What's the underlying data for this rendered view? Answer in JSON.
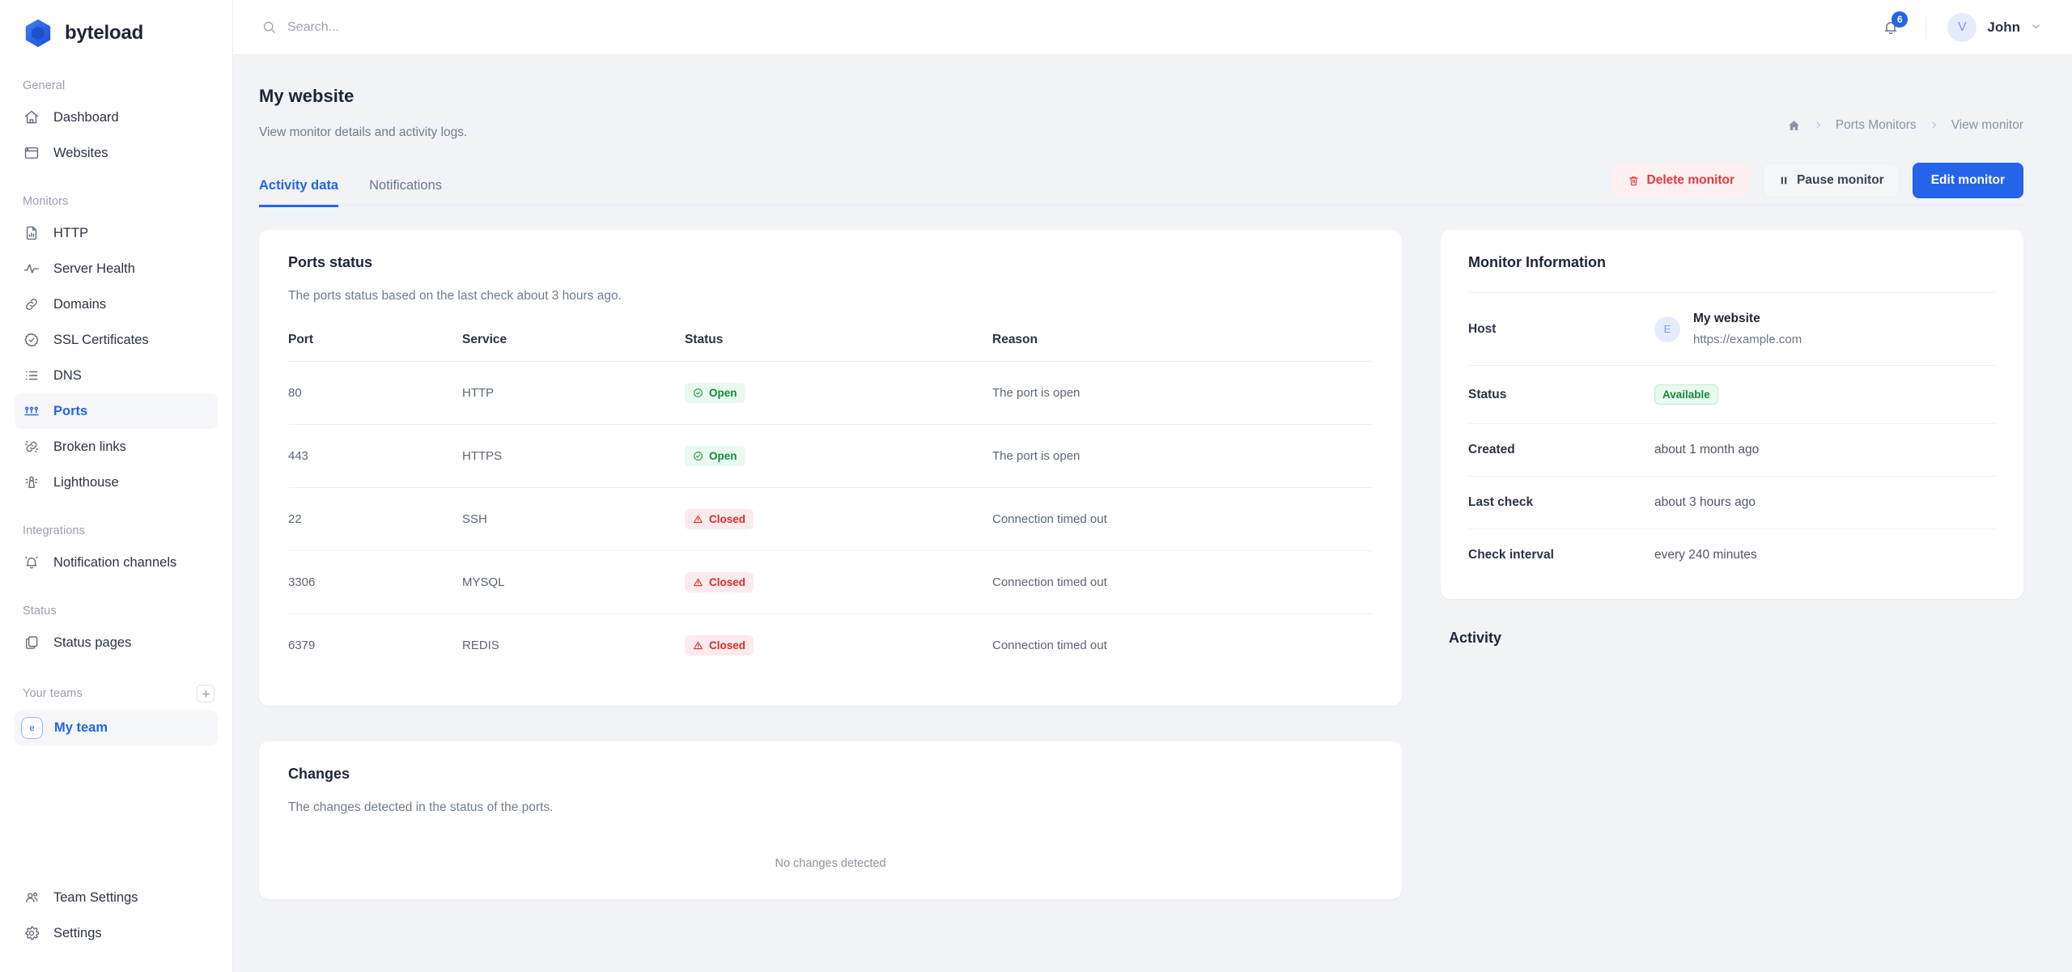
{
  "brand": {
    "name": "byteload",
    "logo_icon": "hexagon-logo",
    "accent": "#2563eb"
  },
  "sidebar": {
    "sections": [
      {
        "label": "General",
        "items": [
          {
            "label": "Dashboard",
            "icon": "home-icon"
          },
          {
            "label": "Websites",
            "icon": "browser-window-icon"
          }
        ]
      },
      {
        "label": "Monitors",
        "items": [
          {
            "label": "HTTP",
            "icon": "document-chart-icon"
          },
          {
            "label": "Server Health",
            "icon": "pulse-icon"
          },
          {
            "label": "Domains",
            "icon": "link-icon"
          },
          {
            "label": "SSL Certificates",
            "icon": "seal-check-icon"
          },
          {
            "label": "DNS",
            "icon": "list-icon"
          },
          {
            "label": "Ports",
            "icon": "ports-icon",
            "active": true
          },
          {
            "label": "Broken links",
            "icon": "broken-link-icon"
          },
          {
            "label": "Lighthouse",
            "icon": "lighthouse-icon"
          }
        ]
      },
      {
        "label": "Integrations",
        "items": [
          {
            "label": "Notification channels",
            "icon": "bell-ring-icon"
          }
        ]
      },
      {
        "label": "Status",
        "items": [
          {
            "label": "Status pages",
            "icon": "copy-pages-icon"
          }
        ]
      }
    ],
    "teams_label": "Your teams",
    "add_team_icon": "plus-icon",
    "team": {
      "label": "My team",
      "avatar_letter": "e"
    },
    "bottom_items": [
      {
        "label": "Team Settings",
        "icon": "users-group-icon"
      },
      {
        "label": "Settings",
        "icon": "gear-icon"
      }
    ]
  },
  "topbar": {
    "search_placeholder": "Search...",
    "search_value": "",
    "search_icon": "search-icon",
    "bell_icon": "bell-icon",
    "notification_count": "6",
    "user": {
      "name": "John",
      "avatar_letter": "V",
      "chevron_icon": "chevron-down-icon"
    }
  },
  "page": {
    "title": "My website",
    "subtitle": "View monitor details and activity logs.",
    "breadcrumb": {
      "home_icon": "home-icon",
      "separator": "›",
      "items": [
        "Ports Monitors",
        "View monitor"
      ]
    },
    "tabs": [
      {
        "label": "Activity data",
        "active": true
      },
      {
        "label": "Notifications",
        "active": false
      }
    ],
    "actions": [
      {
        "label": "Delete monitor",
        "icon": "trash-icon",
        "style": "danger"
      },
      {
        "label": "Pause monitor",
        "icon": "pause-icon",
        "style": "neutral"
      },
      {
        "label": "Edit monitor",
        "icon": "",
        "style": "primary"
      }
    ]
  },
  "ports_card": {
    "title": "Ports status",
    "subtitle": "The ports status based on the last check about 3 hours ago.",
    "columns": [
      "Port",
      "Service",
      "Status",
      "Reason"
    ],
    "rows": [
      {
        "port": "80",
        "service": "HTTP",
        "status": "Open",
        "state": "open",
        "reason": "The port is open"
      },
      {
        "port": "443",
        "service": "HTTPS",
        "status": "Open",
        "state": "open",
        "reason": "The port is open"
      },
      {
        "port": "22",
        "service": "SSH",
        "status": "Closed",
        "state": "closed",
        "reason": "Connection timed out"
      },
      {
        "port": "3306",
        "service": "MYSQL",
        "status": "Closed",
        "state": "closed",
        "reason": "Connection timed out"
      },
      {
        "port": "6379",
        "service": "REDIS",
        "status": "Closed",
        "state": "closed",
        "reason": "Connection timed out"
      }
    ]
  },
  "changes_card": {
    "title": "Changes",
    "subtitle": "The changes detected in the status of the ports.",
    "empty_text": "No changes detected"
  },
  "monitor_info": {
    "title": "Monitor Information",
    "rows": [
      {
        "label": "Host",
        "type": "host",
        "avatar_letter": "E",
        "name": "My website",
        "url": "https://example.com"
      },
      {
        "label": "Status",
        "type": "badge",
        "value": "Available"
      },
      {
        "label": "Created",
        "type": "text",
        "value": "about 1 month ago"
      },
      {
        "label": "Last check",
        "type": "text",
        "value": "about 3 hours ago"
      },
      {
        "label": "Check interval",
        "type": "text",
        "value": "every 240 minutes"
      }
    ]
  },
  "activity": {
    "title": "Activity"
  },
  "colors": {
    "accent": "#2563eb",
    "danger": "#e8363d",
    "success": "#16893e",
    "page_bg": "#f1f3f6",
    "card_bg": "#ffffff"
  }
}
